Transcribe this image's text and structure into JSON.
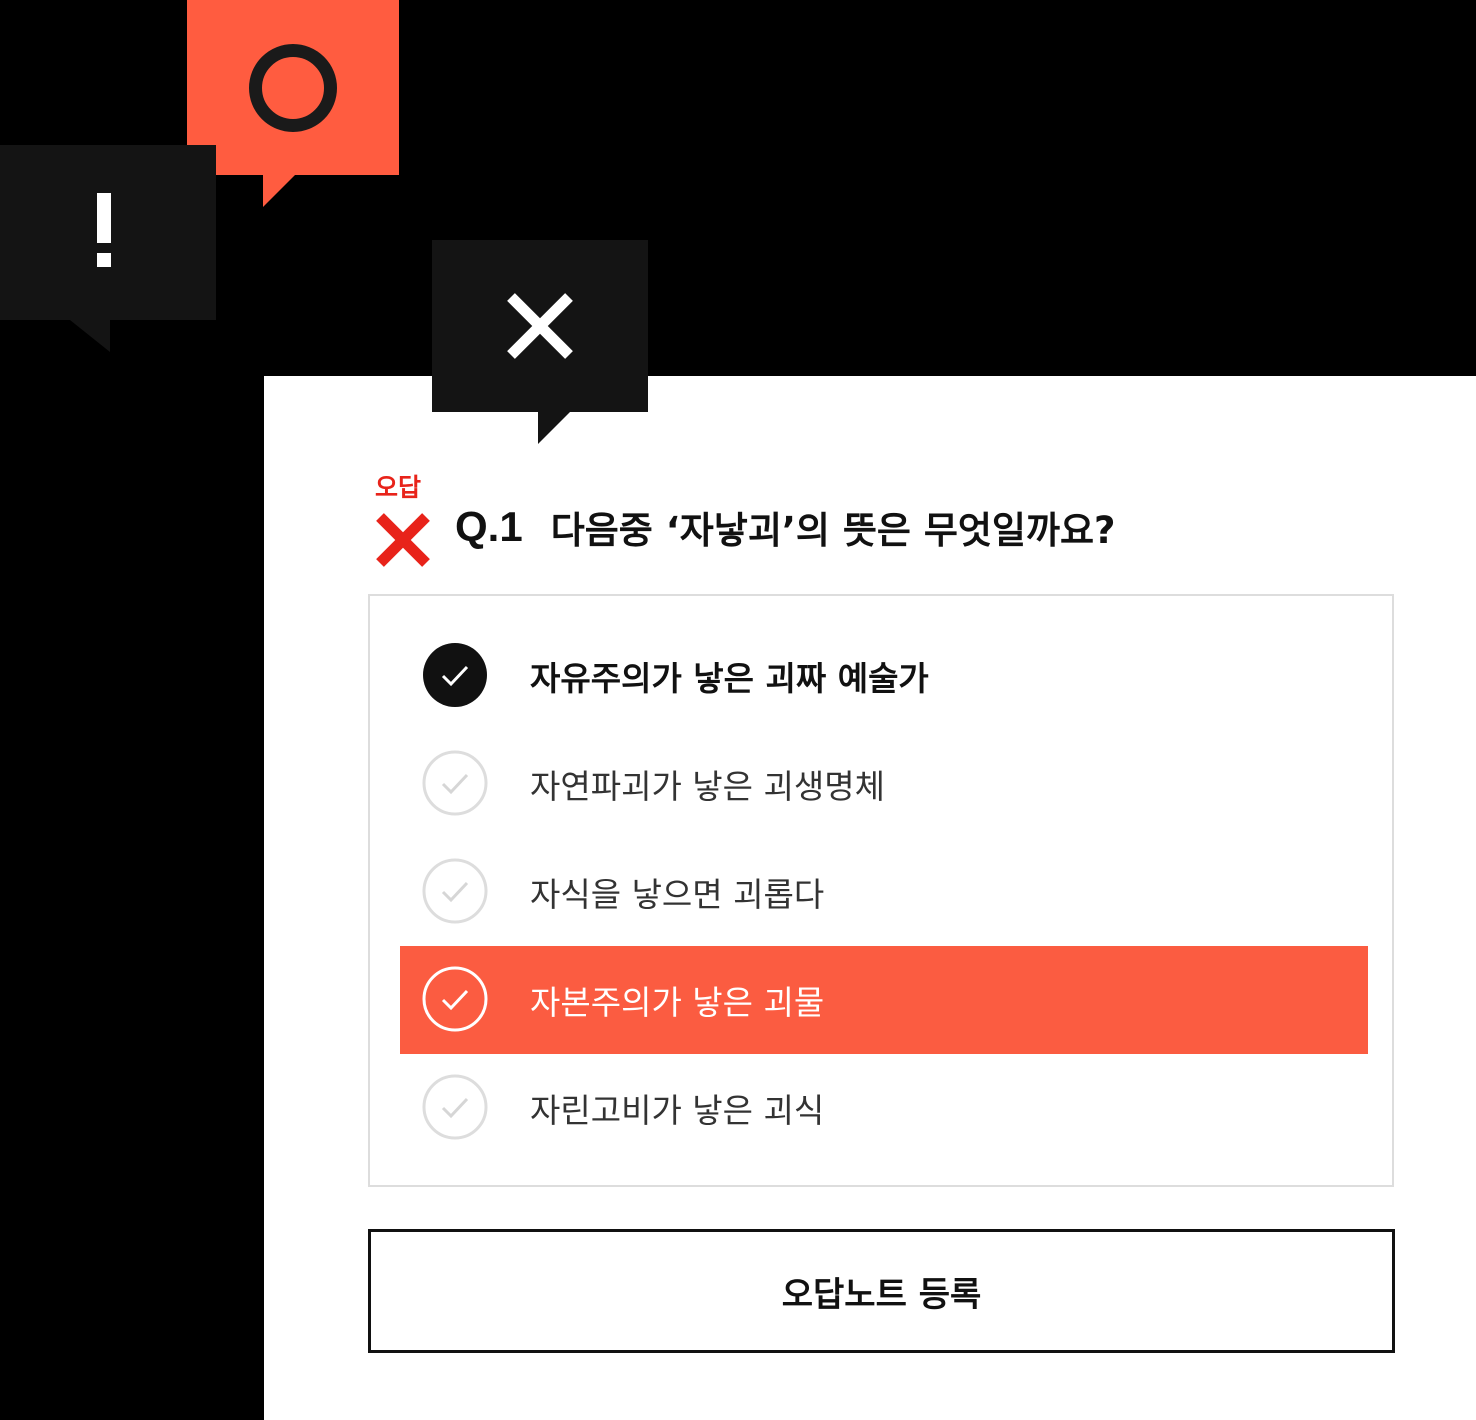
{
  "bubbles": {
    "correct_icon": "circle-o-icon",
    "warning_icon": "exclamation-icon",
    "wrong_icon": "x-mark-icon"
  },
  "question": {
    "result_label": "오답",
    "number": "Q.1",
    "text": "다음중 ‘자낳괴’의 뜻은 무엇일까요?"
  },
  "options": [
    {
      "label": "자유주의가 낳은 괴짜 예술가",
      "state": "selected"
    },
    {
      "label": "자연파괴가 낳은 괴생명체",
      "state": "unselected"
    },
    {
      "label": "자식을 낳으면 괴롭다",
      "state": "unselected"
    },
    {
      "label": "자본주의가 낳은 괴물",
      "state": "correct-answer"
    },
    {
      "label": "자린고비가 낳은 괴식",
      "state": "unselected"
    }
  ],
  "actions": {
    "register_label": "오답노트 등록"
  },
  "colors": {
    "accent": "#fb5c41",
    "wrong": "#e8231a",
    "dark": "#141414"
  }
}
